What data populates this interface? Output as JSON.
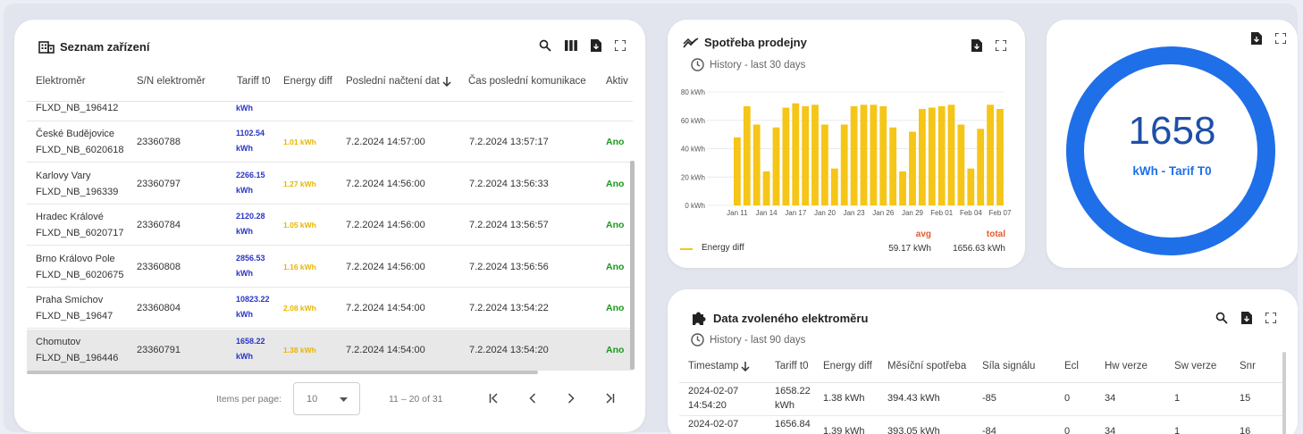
{
  "device_list": {
    "title": "Seznam zařízení",
    "icons": [
      "search-icon",
      "columns-icon",
      "export-file-icon",
      "fullscreen-icon"
    ],
    "columns": [
      "Elektroměr",
      "S/N elektroměr",
      "Tariff t0",
      "Energy diff",
      "Poslední načtení dat",
      "Čas poslední komunikace",
      "Aktiv"
    ],
    "partial_row": {
      "name": "FLXD_NB_196412",
      "tarif": "kWh"
    },
    "rows": [
      {
        "city": "České Budějovice",
        "device": "FLXD_NB_6020618",
        "sn": "23360788",
        "tarif": "1102.54",
        "tarif_unit": "kWh",
        "ediff": "1.01 kWh",
        "last_read": "7.2.2024 14:57:00",
        "last_comm": "7.2.2024 13:57:17",
        "active": "Ano"
      },
      {
        "city": "Karlovy Vary",
        "device": "FLXD_NB_196339",
        "sn": "23360797",
        "tarif": "2266.15",
        "tarif_unit": "kWh",
        "ediff": "1.27 kWh",
        "last_read": "7.2.2024 14:56:00",
        "last_comm": "7.2.2024 13:56:33",
        "active": "Ano"
      },
      {
        "city": "Hradec Králové",
        "device": "FLXD_NB_6020717",
        "sn": "23360784",
        "tarif": "2120.28",
        "tarif_unit": "kWh",
        "ediff": "1.05 kWh",
        "last_read": "7.2.2024 14:56:00",
        "last_comm": "7.2.2024 13:56:57",
        "active": "Ano"
      },
      {
        "city": "Brno Královo Pole",
        "device": "FLXD_NB_6020675",
        "sn": "23360808",
        "tarif": "2856.53",
        "tarif_unit": "kWh",
        "ediff": "1.16 kWh",
        "last_read": "7.2.2024 14:56:00",
        "last_comm": "7.2.2024 13:56:56",
        "active": "Ano"
      },
      {
        "city": "Praha Smíchov",
        "device": "FLXD_NB_19647",
        "sn": "23360804",
        "tarif": "10823.22",
        "tarif_unit": "kWh",
        "ediff": "2.08 kWh",
        "last_read": "7.2.2024 14:54:00",
        "last_comm": "7.2.2024 13:54:22",
        "active": "Ano"
      },
      {
        "city": "Chomutov",
        "device": "FLXD_NB_196446",
        "sn": "23360791",
        "tarif": "1658.22",
        "tarif_unit": "kWh",
        "ediff": "1.38 kWh",
        "last_read": "7.2.2024 14:54:00",
        "last_comm": "7.2.2024 13:54:20",
        "active": "Ano"
      }
    ],
    "paginator": {
      "items_label": "Items per page:",
      "page_size": "10",
      "range": "11 – 20 of 31"
    }
  },
  "consumption": {
    "title": "Spotřeba prodejny",
    "history": "History - last 30 days",
    "legend": "Energy diff",
    "avg_label": "avg",
    "avg_value": "59.17 kWh",
    "total_label": "total",
    "total_value": "1656.63 kWh"
  },
  "gauge": {
    "value": "1658",
    "label": "kWh - Tarif T0",
    "fill": 1.0,
    "color": "#1f6fe8"
  },
  "selected_meter": {
    "title": "Data zvoleného elektroměru",
    "history": "History - last 90 days",
    "columns": [
      "Timestamp",
      "Tariff t0",
      "Energy diff",
      "Měsíční spotřeba",
      "Síla signálu",
      "Ecl",
      "Hw verze",
      "Sw verze",
      "Snr"
    ],
    "rows": [
      {
        "ts1": "2024-02-07",
        "ts2": "14:54:20",
        "t0a": "1658.22",
        "t0b": "kWh",
        "ediff": "1.38 kWh",
        "month": "394.43 kWh",
        "signal": "-85",
        "ecl": "0",
        "hw": "34",
        "sw": "1",
        "snr": "15"
      },
      {
        "ts1": "2024-02-07",
        "ts2": "",
        "t0a": "1656.84",
        "t0b": "",
        "ediff": "1.39 kWh",
        "month": "393.05 kWh",
        "signal": "-84",
        "ecl": "0",
        "hw": "34",
        "sw": "1",
        "snr": "16"
      }
    ]
  },
  "chart_data": {
    "type": "bar",
    "title": "Spotřeba prodejny",
    "series": [
      {
        "name": "Energy diff",
        "color": "#f5c518",
        "values": [
          48,
          70,
          57,
          24,
          55,
          69,
          72,
          70,
          71,
          57,
          26,
          57,
          70,
          71,
          71,
          70,
          55,
          24,
          52,
          68,
          69,
          70,
          71,
          57,
          26,
          54,
          71,
          68
        ]
      }
    ],
    "x_tick_labels": [
      "Jan 11",
      "Jan 14",
      "Jan 17",
      "Jan 20",
      "Jan 23",
      "Jan 26",
      "Jan 29",
      "Feb 01",
      "Feb 04",
      "Feb 07"
    ],
    "y_tick_labels": [
      "0 kWh",
      "20 kWh",
      "40 kWh",
      "60 kWh",
      "80 kWh"
    ],
    "ylim": [
      0,
      80
    ],
    "grid": true
  }
}
